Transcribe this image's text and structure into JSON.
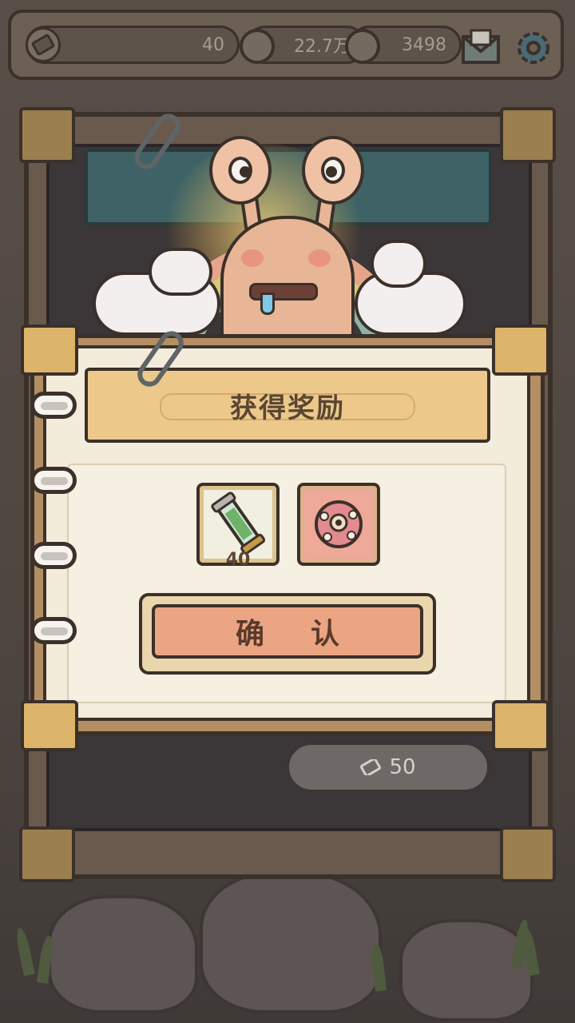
{
  "status_bar": {
    "tickets": {
      "icon": "ticket-icon",
      "value": "40"
    },
    "currency_a": {
      "icon": "speech-bubble-icon",
      "value": "22.7万"
    },
    "currency_b": {
      "icon": "speech-bubble-icon",
      "value": "3498"
    },
    "mail_icon": "mail-icon",
    "settings_icon": "gear-icon"
  },
  "background_card": {
    "price": {
      "icon": "ticket-icon",
      "value": "50"
    }
  },
  "dialog": {
    "title": "获得奖励",
    "rewards": [
      {
        "icon": "seed-tube-icon",
        "count": "40"
      },
      {
        "icon": "pink-shell-orb-icon",
        "count": ""
      }
    ],
    "confirm_label": "确认"
  },
  "colors": {
    "dialog_frame": "#b48f63",
    "paper": "#f4ecdb",
    "title_banner": "#ecc98b",
    "confirm_button": "#eba582",
    "outline": "#3b302a"
  }
}
